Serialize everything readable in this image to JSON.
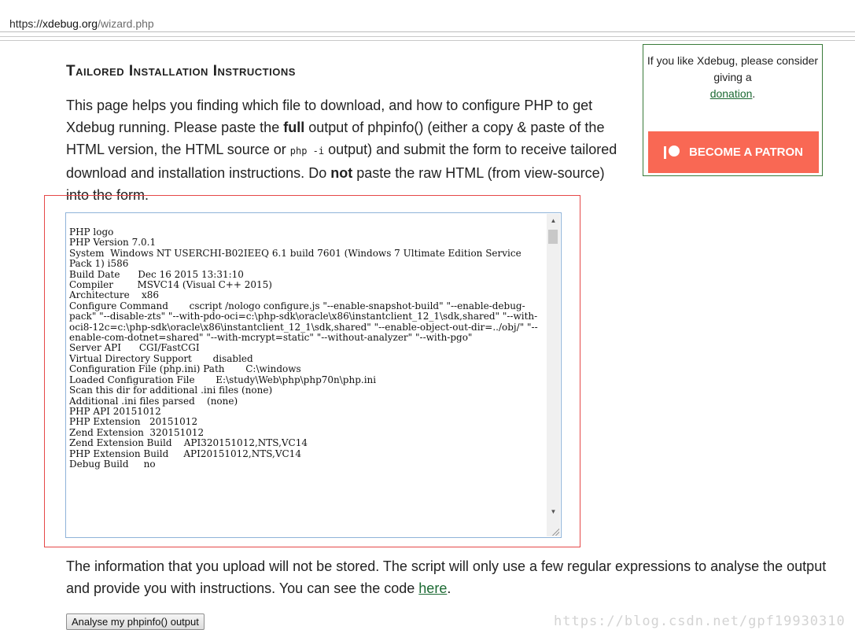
{
  "browser": {
    "url_scheme": "https://",
    "url_host": "xdebug.org",
    "url_path": "/wizard.php"
  },
  "heading": "Tailored Installation Instructions",
  "intro": {
    "part1": "This page helps you finding which file to download, and how to configure PHP to get Xdebug running. Please paste the ",
    "bold1": "full",
    "part2": " output of phpinfo() (either a copy & paste of the HTML version, the HTML source or ",
    "code": "php -i",
    "part3": " output) and submit the form to receive tailored download and installation instructions. Do ",
    "bold2": "not",
    "part4": " paste the raw HTML (from view-source) into the form."
  },
  "sidebar": {
    "donate_text": "If you like Xdebug, please consider giving a",
    "donate_link": "donation",
    "donate_suffix": ".",
    "patron_label": "BECOME A PATRON"
  },
  "phpinfo_output": "PHP logo\nPHP Version 7.0.1\nSystem  Windows NT USERCHI-B02IEEQ 6.1 build 7601 (Windows 7 Ultimate Edition Service Pack 1) i586\nBuild Date      Dec 16 2015 13:31:10\nCompiler        MSVC14 (Visual C++ 2015)\nArchitecture    x86\nConfigure Command       cscript /nologo configure.js \"--enable-snapshot-build\" \"--enable-debug-pack\" \"--disable-zts\" \"--with-pdo-oci=c:\\php-sdk\\oracle\\x86\\instantclient_12_1\\sdk,shared\" \"--with-oci8-12c=c:\\php-sdk\\oracle\\x86\\instantclient_12_1\\sdk,shared\" \"--enable-object-out-dir=../obj/\" \"--enable-com-dotnet=shared\" \"--with-mcrypt=static\" \"--without-analyzer\" \"--with-pgo\"\nServer API      CGI/FastCGI\nVirtual Directory Support       disabled\nConfiguration File (php.ini) Path       C:\\windows\nLoaded Configuration File       E:\\study\\Web\\php\\php70n\\php.ini\nScan this dir for additional .ini files (none)\nAdditional .ini files parsed    (none)\nPHP API 20151012\nPHP Extension   20151012\nZend Extension  320151012\nZend Extension Build    API320151012,NTS,VC14\nPHP Extension Build     API20151012,NTS,VC14\nDebug Build     no",
  "outro": {
    "text": "The information that you upload will not be stored. The script will only use a few regular expressions to analyse the output and provide you with instructions. You can see the code ",
    "link": "here",
    "suffix": "."
  },
  "submit_label": "Analyse my phpinfo() output",
  "watermark": "https://blog.csdn.net/gpf19930310",
  "colors": {
    "patron": "#f96854",
    "link": "#1c6a33",
    "highlight_box": "#e54848"
  }
}
